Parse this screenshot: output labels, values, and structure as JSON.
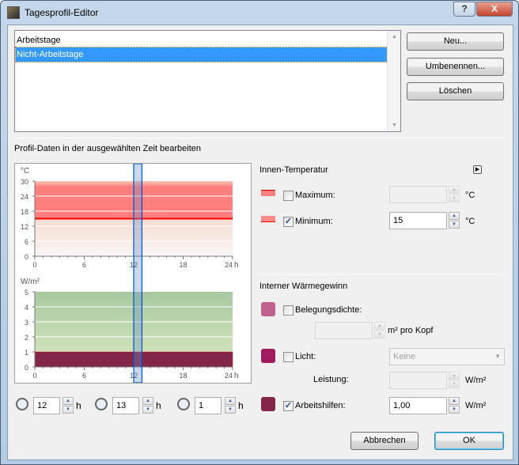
{
  "window": {
    "title": "Tagesprofil-Editor",
    "help": "?",
    "close": "X"
  },
  "profiles": {
    "items": [
      "Arbeitstage",
      "Nicht-Arbeitstage"
    ],
    "selected": 1
  },
  "buttons": {
    "new": "Neu...",
    "rename": "Umbenennen...",
    "delete": "Löschen",
    "cancel": "Abbrechen",
    "ok": "OK"
  },
  "section_label": "Profil-Daten in der ausgewählten Zeit bearbeiten",
  "chart_data": [
    {
      "type": "area",
      "title": "Innen-Temperatur",
      "ylabel": "°C",
      "xlabel": "h",
      "xlim": [
        0,
        24
      ],
      "ylim": [
        0,
        30
      ],
      "yticks": [
        "0",
        "6",
        "12",
        "18",
        "24",
        "30"
      ],
      "xticks": [
        "0",
        "6",
        "12",
        "18",
        "24"
      ],
      "series": [
        {
          "name": "Minimum",
          "values": [
            15
          ],
          "color": "#ff0000"
        }
      ],
      "selection": [
        12,
        13
      ]
    },
    {
      "type": "area",
      "title": "Interner Wärmegewinn",
      "ylabel": "W/m²",
      "xlabel": "h",
      "xlim": [
        0,
        24
      ],
      "ylim": [
        0,
        5
      ],
      "yticks": [
        "0",
        "1",
        "2",
        "3",
        "4",
        "5"
      ],
      "xticks": [
        "0",
        "6",
        "12",
        "18",
        "24"
      ],
      "series": [
        {
          "name": "Arbeitshilfen",
          "values": [
            1.0
          ],
          "color": "#84264a"
        }
      ],
      "selection": [
        12,
        13
      ]
    }
  ],
  "time": {
    "start": "12",
    "end": "13",
    "duration": "1",
    "unit": "h"
  },
  "temperature": {
    "heading": "Innen-Temperatur",
    "maximum": {
      "label": "Maximum:",
      "checked": false,
      "value": "",
      "unit": "°C"
    },
    "minimum": {
      "label": "Minimum:",
      "checked": true,
      "value": "15",
      "unit": "°C"
    }
  },
  "gain": {
    "heading": "Interner Wärmegewinn",
    "occupancy": {
      "label": "Belegungsdichte:",
      "checked": false,
      "value": "",
      "unit": "m² pro Kopf",
      "color": "#bf638e"
    },
    "light": {
      "label": "Licht:",
      "checked": false,
      "select": "Keine",
      "color": "#a01c5e"
    },
    "power": {
      "label": "Leistung:",
      "value": "",
      "unit": "W/m²"
    },
    "equipment": {
      "label": "Arbeitshilfen:",
      "checked": true,
      "value": "1,00",
      "unit": "W/m²",
      "color": "#84264a"
    }
  }
}
